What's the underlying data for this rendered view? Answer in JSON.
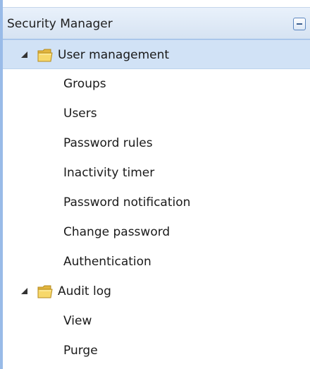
{
  "panel": {
    "title": "Security Manager",
    "collapse_icon": "minus-icon"
  },
  "tree": {
    "groups": [
      {
        "label": "User management",
        "icon": "folder-icon",
        "expanded": true,
        "selected": true,
        "items": [
          {
            "label": "Groups"
          },
          {
            "label": "Users"
          },
          {
            "label": "Password rules"
          },
          {
            "label": "Inactivity timer"
          },
          {
            "label": "Password notification"
          },
          {
            "label": "Change password"
          },
          {
            "label": "Authentication"
          }
        ]
      },
      {
        "label": "Audit log",
        "icon": "folder-icon",
        "expanded": true,
        "selected": false,
        "items": [
          {
            "label": "View"
          },
          {
            "label": "Purge"
          }
        ]
      }
    ]
  },
  "colors": {
    "panel_border": "#99bbe8",
    "header_bg": "#d6e3f2",
    "selected_row_bg": "#d1e2f6",
    "folder_yellow": "#f2c94c"
  }
}
